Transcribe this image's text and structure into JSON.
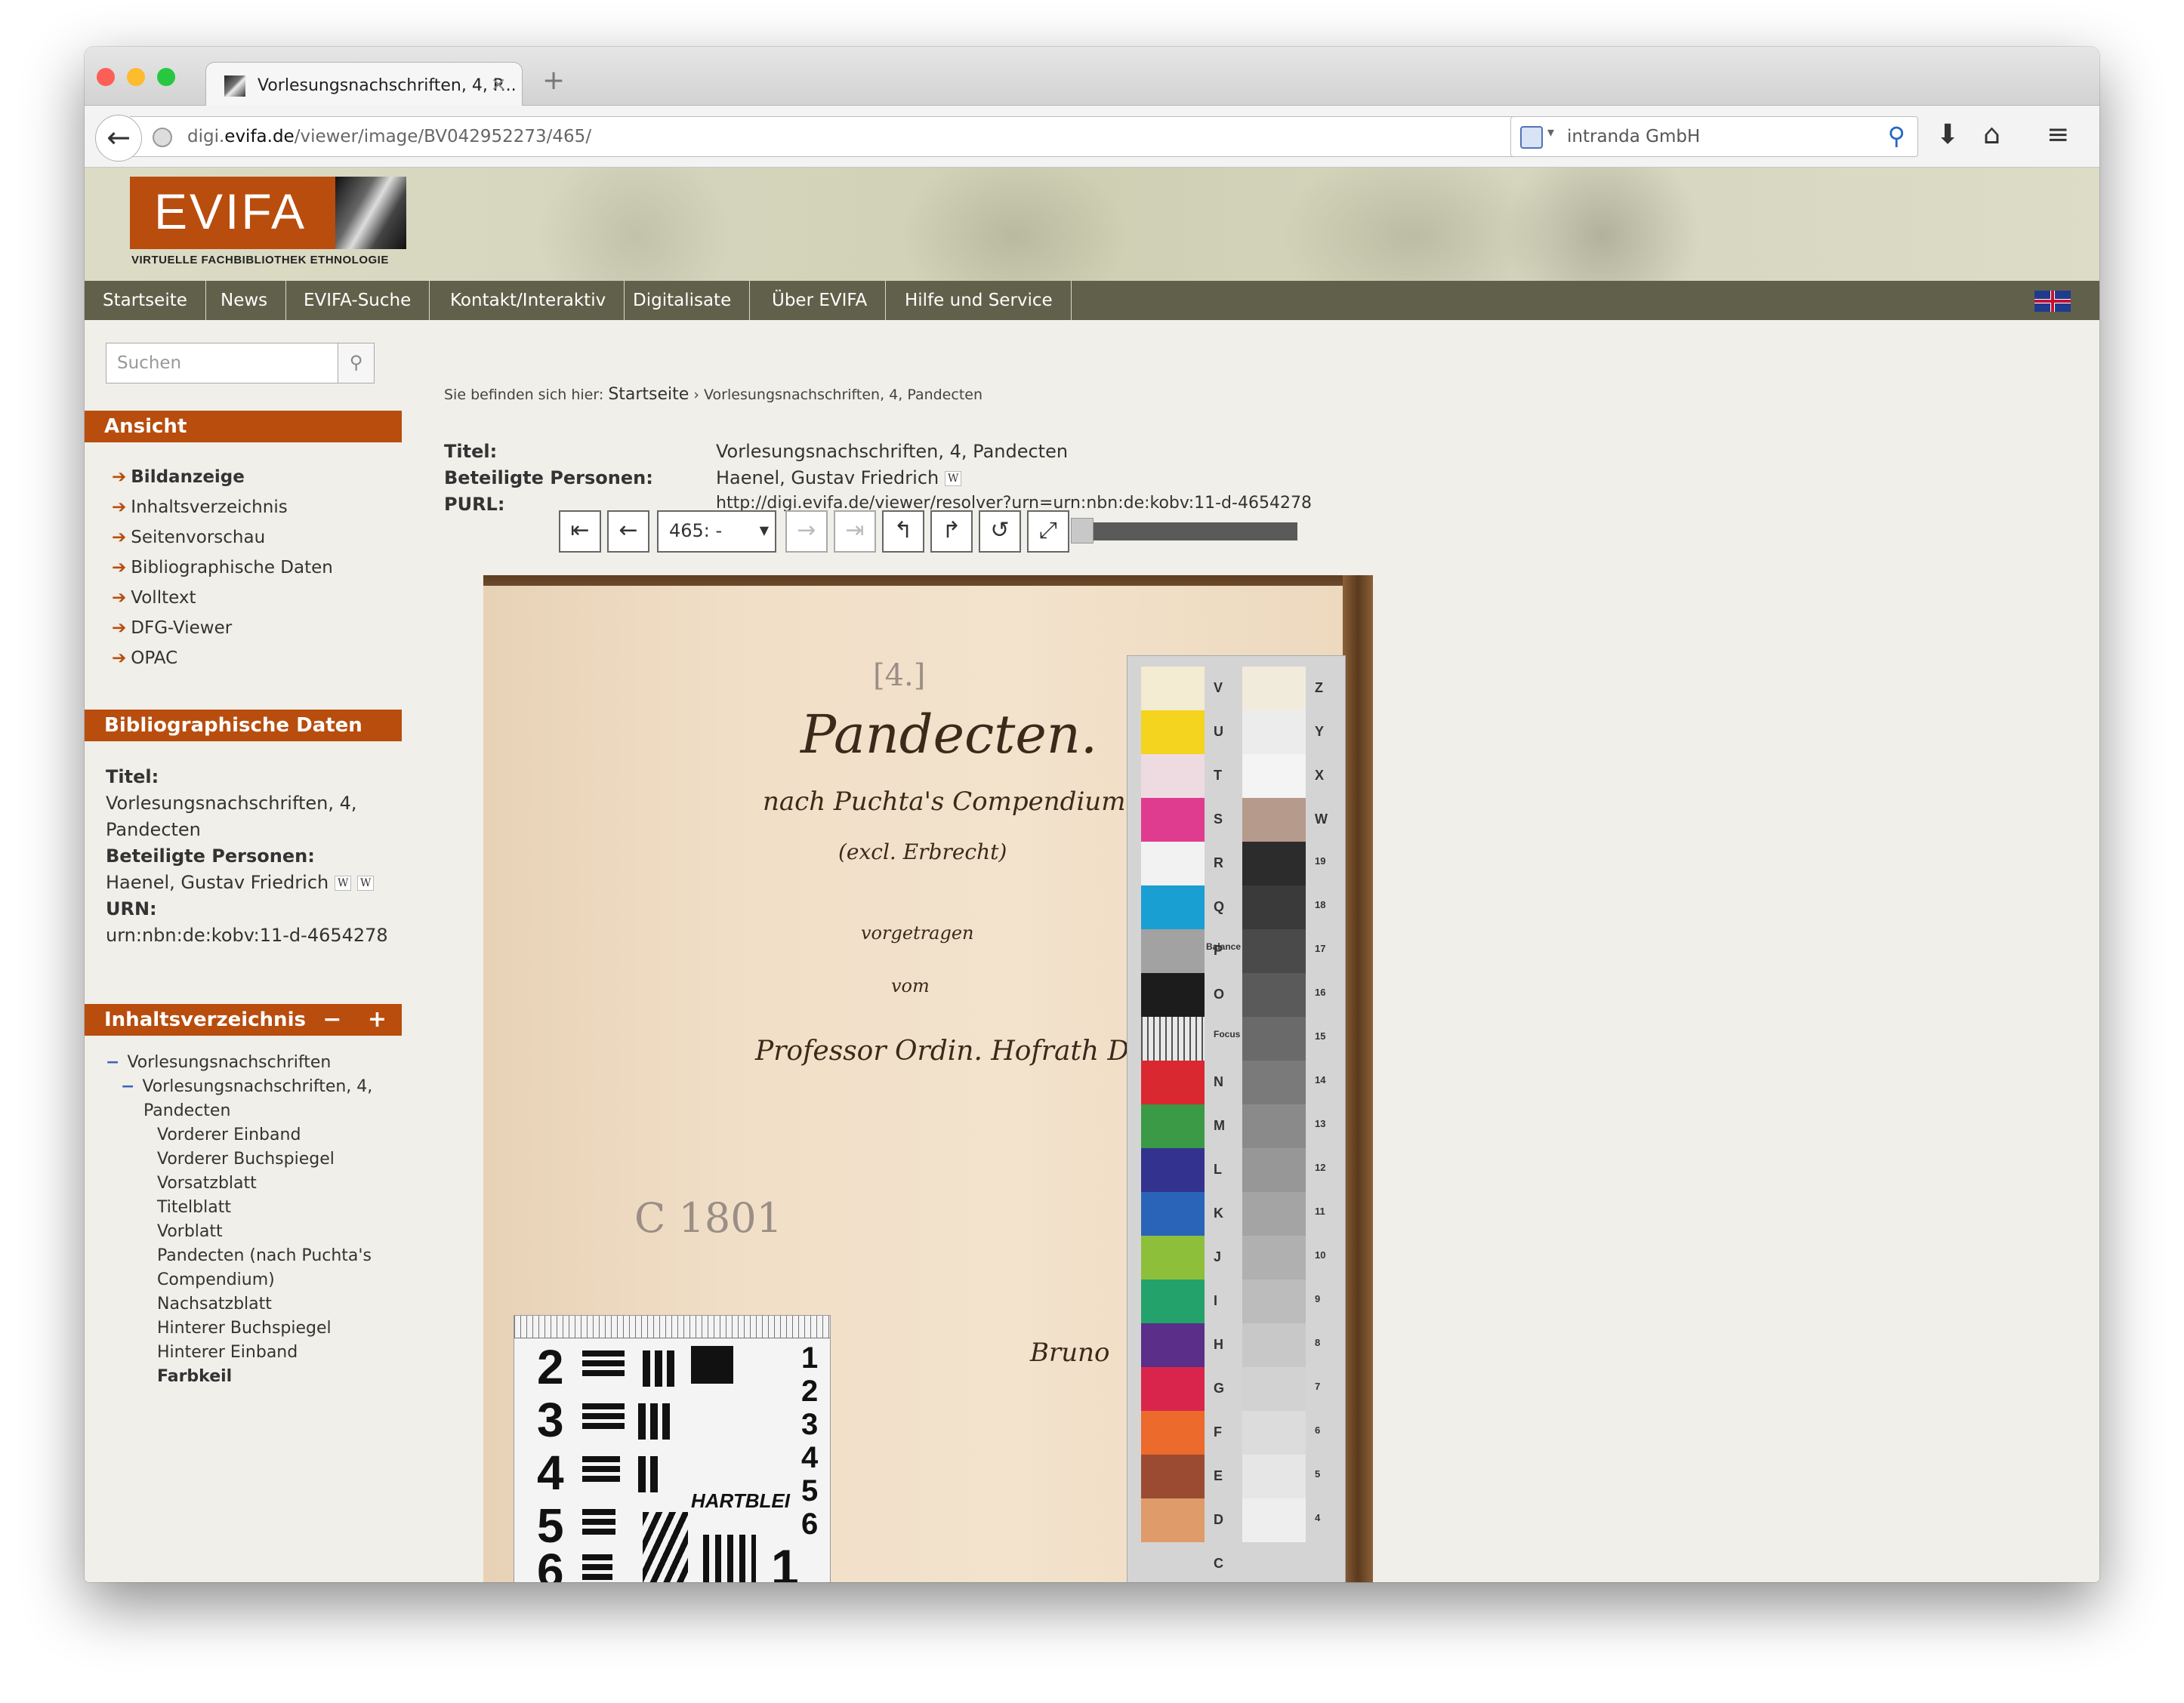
{
  "browser": {
    "tab_title": "Vorlesungsnachschriften, 4, P...",
    "url_host_prefix": "digi.",
    "url_host_main": "evifa.de",
    "url_path": "/viewer/image/BV042952273/465/",
    "search_engine_text": "intranda GmbH",
    "colors": {
      "close": "#fc5f57",
      "minimize": "#fdbb2e",
      "maximize": "#27c840"
    }
  },
  "site": {
    "logo_text": "EVIFA",
    "logo_subtitle": "VIRTUELLE  FACHBIBLIOTHEK  ETHNOLOGIE",
    "brand_color": "#b84d0e",
    "menu": [
      "Startseite",
      "News",
      "EVIFA-Suche",
      "Kontakt/Interaktiv",
      "Digitalisate",
      "Über EVIFA",
      "Hilfe und Service"
    ],
    "language_icon": "uk-flag-icon"
  },
  "sidebar": {
    "search_placeholder": "Suchen",
    "ansicht_title": "Ansicht",
    "ansicht_items": [
      "Bildanzeige",
      "Inhaltsverzeichnis",
      "Seitenvorschau",
      "Bibliographische Daten",
      "Volltext",
      "DFG-Viewer",
      "OPAC"
    ],
    "bib_title": "Bibliographische Daten",
    "bib_titel_label": "Titel:",
    "bib_titel_value": "Vorlesungsnachschriften, 4, Pandecten",
    "bib_person_label": "Beteiligte Personen:",
    "bib_person_value": "Haenel, Gustav Friedrich",
    "bib_urn_label": "URN:",
    "bib_urn_value": "urn:nbn:de:kobv:11-d-4654278",
    "toc_title": "Inhaltsverzeichnis",
    "toc_controls": "− +",
    "toc_level1": "Vorlesungsnachschriften",
    "toc_level2_a": "Vorlesungsnachschriften, 4,",
    "toc_level2_b": "Pandecten",
    "toc_items": [
      "Vorderer Einband",
      "Vorderer Buchspiegel",
      "Vorsatzblatt",
      "Titelblatt",
      "Vorblatt",
      "Pandecten (nach Puchta's",
      "Compendium)",
      "Nachsatzblatt",
      "Hinterer Buchspiegel",
      "Hinterer Einband"
    ],
    "toc_active": "Farbkeil"
  },
  "main": {
    "breadcrumb_prefix": "Sie befinden sich hier:",
    "breadcrumb_home": "Startseite",
    "breadcrumb_sep": "›",
    "breadcrumb_current": "Vorlesungsnachschriften, 4, Pandecten",
    "titel_label": "Titel:",
    "titel_value": "Vorlesungsnachschriften, 4, Pandecten",
    "person_label": "Beteiligte Personen:",
    "person_value": "Haenel, Gustav Friedrich",
    "purl_label": "PURL:",
    "purl_value": "http://digi.evifa.de/viewer/resolver?urn=urn:nbn:de:kobv:11-d-4654278",
    "page_select": "465: -",
    "zoom_level": 0.02
  },
  "scan": {
    "mark": "[4.]",
    "title": "Pandecten.",
    "line2": "nach Puchta's Compendium",
    "line3": "(excl. Erbrecht)",
    "line4": "vorgetragen",
    "line5": "vom",
    "line6": "Professor Ordin. Hofrath Dr. Haenel.",
    "signature": "C 1801",
    "corner_note": "Bruno",
    "strip_left_letters": [
      "V",
      "U",
      "T",
      "S",
      "R",
      "Q",
      "P",
      "O",
      "N",
      "M",
      "L",
      "K",
      "J",
      "I",
      "H",
      "G",
      "F",
      "E",
      "D",
      "C"
    ],
    "strip_right_letters": [
      "Z",
      "Y",
      "X",
      "W",
      "19",
      "18",
      "17",
      "16",
      "15",
      "14",
      "13",
      "12",
      "11",
      "10",
      "9",
      "8",
      "7",
      "6",
      "5",
      "4"
    ],
    "strip_balance": "Balance",
    "strip_focus": "Focus",
    "target_brand": "HARTBLEI",
    "target_numbers": [
      "2",
      "3",
      "4",
      "5",
      "6"
    ],
    "target_right_numbers": [
      "1",
      "2",
      "3",
      "4",
      "5",
      "6",
      "1"
    ]
  }
}
